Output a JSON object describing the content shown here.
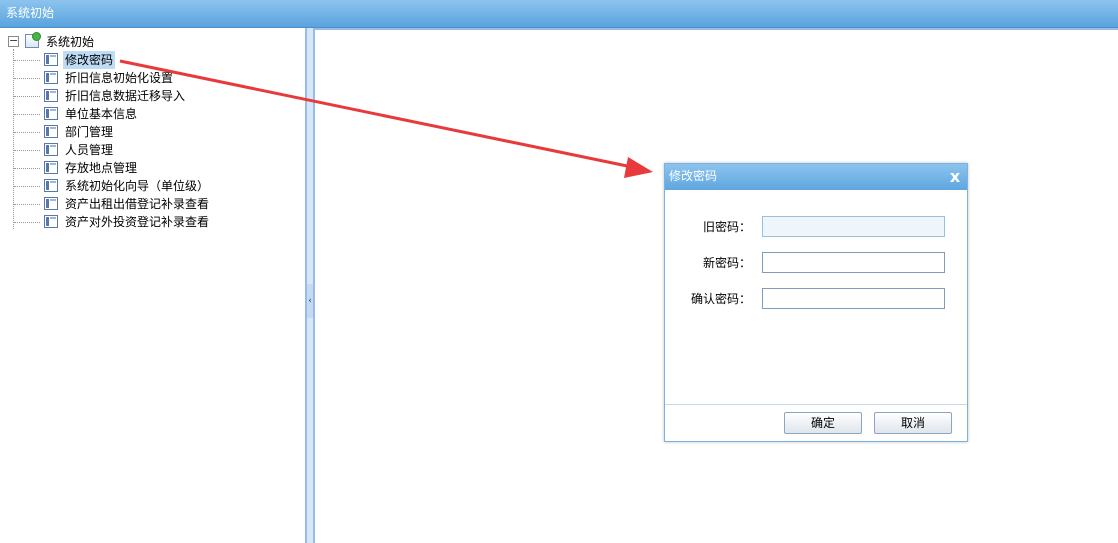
{
  "window": {
    "title": "系统初始"
  },
  "tree": {
    "root_label": "系统初始",
    "expander": "−",
    "items": [
      {
        "label": "修改密码",
        "selected": true
      },
      {
        "label": "折旧信息初始化设置"
      },
      {
        "label": "折旧信息数据迁移导入"
      },
      {
        "label": "单位基本信息"
      },
      {
        "label": "部门管理"
      },
      {
        "label": "人员管理"
      },
      {
        "label": "存放地点管理"
      },
      {
        "label": "系统初始化向导（单位级）"
      },
      {
        "label": "资产出租出借登记补录查看"
      },
      {
        "label": "资产对外投资登记补录查看"
      }
    ]
  },
  "splitter": {
    "handle_glyph": "‹"
  },
  "dialog": {
    "title": "修改密码",
    "close_glyph": "x",
    "fields": [
      {
        "label": "旧密码：",
        "value": ""
      },
      {
        "label": "新密码：",
        "value": ""
      },
      {
        "label": "确认密码：",
        "value": ""
      }
    ],
    "ok_label": "确定",
    "cancel_label": "取消"
  },
  "annotation": {
    "arrow_color": "#e8393b"
  },
  "colors": {
    "title_bar": "#5aa3de",
    "border": "#99bbe8",
    "selection": "#bedcf6"
  }
}
